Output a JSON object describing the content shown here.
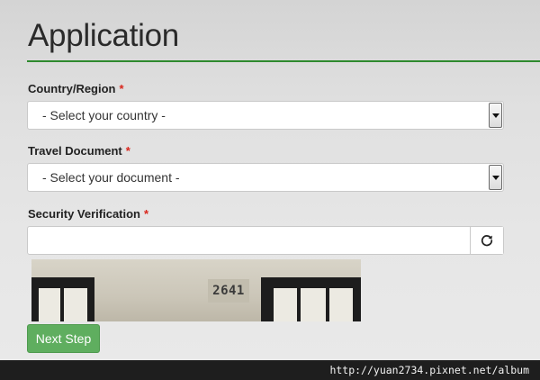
{
  "page": {
    "title": "Application"
  },
  "form": {
    "country": {
      "label": "Country/Region",
      "required_mark": "*",
      "selected": "- Select your country -"
    },
    "document": {
      "label": "Travel Document",
      "required_mark": "*",
      "selected": "- Select your document -"
    },
    "security": {
      "label": "Security Verification",
      "required_mark": "*",
      "value": "",
      "placeholder": "",
      "refresh_icon": "refresh-icon",
      "captcha_text": "2641"
    },
    "next_button": "Next Step"
  },
  "footer": {
    "watermark": "http://yuan2734.pixnet.net/album"
  },
  "colors": {
    "accent_rule": "#2f8a2f",
    "primary_button": "#5fae5f",
    "required": "#d9261c"
  }
}
